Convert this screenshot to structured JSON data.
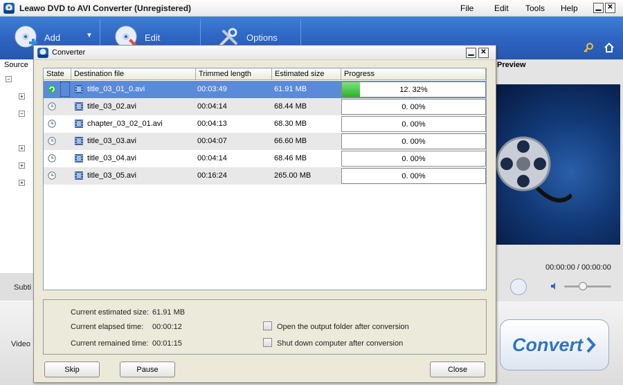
{
  "window": {
    "title": "Leawo DVD to AVI Converter  (Unregistered)",
    "menu": [
      "File",
      "Edit",
      "Tools",
      "Help"
    ],
    "minimize_glyph": "▁",
    "close_glyph": "✕"
  },
  "toolbar": {
    "add_label": "Add",
    "edit_label": "Edit",
    "options_label": "Options",
    "dropdown_glyph": "▼"
  },
  "side": {
    "source_label": "Source",
    "subtitle_label": "Subti",
    "video_label": "Video",
    "tree_expand_glyph": "+",
    "tree_collapse_glyph": "−"
  },
  "preview": {
    "label": "Preview",
    "time": "00:00:00 / 00:00:00",
    "volume_level": 0.4
  },
  "convert_label": "Convert",
  "dialog": {
    "title": "Converter",
    "minimize_glyph": "▁",
    "close_glyph": "✕",
    "columns": [
      "State",
      "Destination file",
      "Trimmed length",
      "Estimated size",
      "Progress"
    ],
    "rows": [
      {
        "state": "converting",
        "file": "title_03_01_0.avi",
        "length": "00:03:49",
        "size": "61.91 MB",
        "progress": "12. 32%",
        "progress_value": 12.32
      },
      {
        "state": "waiting",
        "file": "title_03_02.avi",
        "length": "00:04:14",
        "size": "68.44 MB",
        "progress": "0. 00%",
        "progress_value": 0
      },
      {
        "state": "waiting",
        "file": "chapter_03_02_01.avi",
        "length": "00:04:13",
        "size": "68.30 MB",
        "progress": "0. 00%",
        "progress_value": 0
      },
      {
        "state": "waiting",
        "file": "title_03_03.avi",
        "length": "00:04:07",
        "size": "66.60 MB",
        "progress": "0. 00%",
        "progress_value": 0
      },
      {
        "state": "waiting",
        "file": "title_03_04.avi",
        "length": "00:04:14",
        "size": "68.46 MB",
        "progress": "0. 00%",
        "progress_value": 0
      },
      {
        "state": "waiting",
        "file": "title_03_05.avi",
        "length": "00:16:24",
        "size": "265.00 MB",
        "progress": "0. 00%",
        "progress_value": 0
      }
    ],
    "info": {
      "size_label": "Current estimated size:",
      "size_value": "61.91 MB",
      "elapsed_label": "Current elapsed time:",
      "elapsed_value": "00:00:12",
      "remained_label": "Current remained time:",
      "remained_value": "00:01:15"
    },
    "options": {
      "open_folder": "Open the output folder after conversion",
      "shutdown": "Shut down computer after conversion"
    },
    "buttons": {
      "skip": "Skip",
      "pause": "Pause",
      "close": "Close"
    }
  },
  "colors": {
    "toolbar_blue": "#2f67c4",
    "selected_row": "#5b8ad9",
    "progress_green": "#28b428",
    "convert_text": "#2e73c8"
  },
  "icons": {
    "app": "leawo-avi-icon",
    "add": "dvd-add-icon",
    "edit": "dvd-edit-icon",
    "options": "tools-icon",
    "register": "key-icon",
    "home": "home-icon",
    "converting": "converting-icon",
    "waiting": "clock-icon",
    "file": "film-icon"
  }
}
